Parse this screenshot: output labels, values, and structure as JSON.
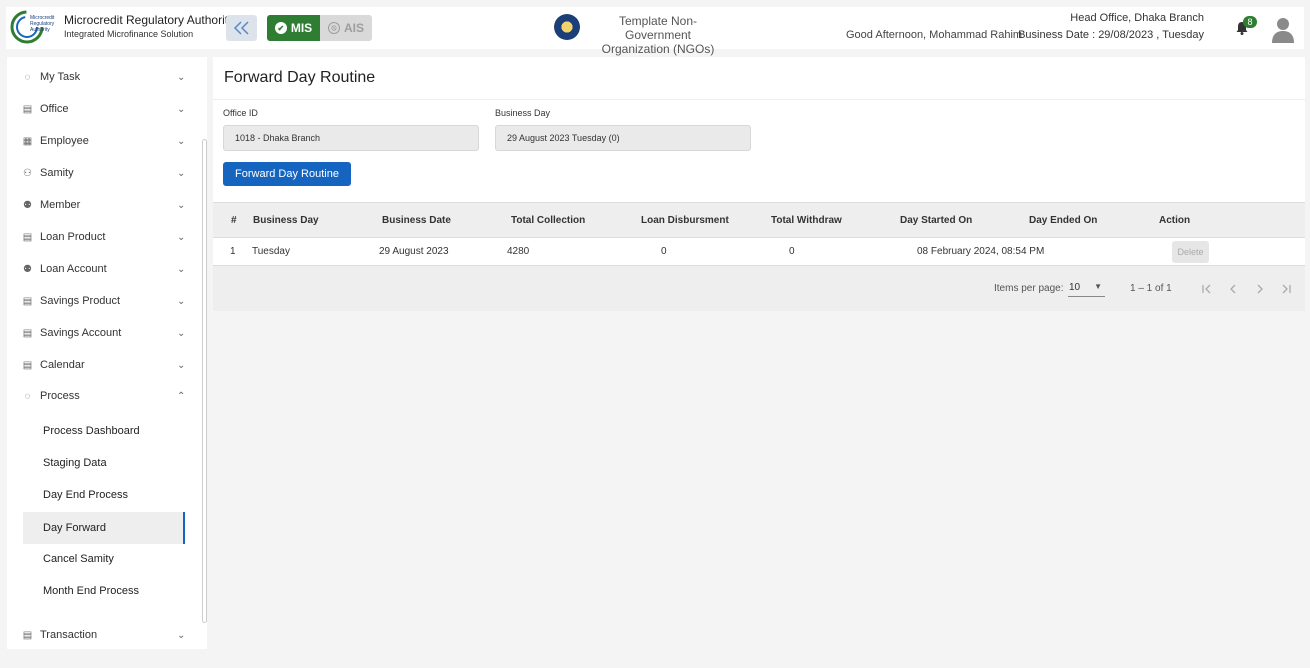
{
  "header": {
    "logo_text": [
      "Microcredit",
      "Regulatory",
      "Authority"
    ],
    "brand_title": "Microcredit Regulatory Authority",
    "brand_subtitle": "Integrated Microfinance Solution",
    "toggle": {
      "mis": "MIS",
      "ais": "AIS",
      "active": "MIS"
    },
    "ngo_name_line1": "Template Non-Government",
    "ngo_name_line2": "Organization (NGOs)",
    "greeting": "Good Afternoon, Mohammad Rahim",
    "branch": "Head Office, Dhaka Branch",
    "business_date": "Business Date : 29/08/2023 , Tuesday",
    "notification_count": "8",
    "colors": {
      "accent": "#2e7d32",
      "primary": "#1565c0"
    }
  },
  "sidebar": {
    "items": [
      {
        "label": "My Task",
        "icon": "task-icon",
        "expanded": false
      },
      {
        "label": "Office",
        "icon": "office-icon",
        "expanded": false
      },
      {
        "label": "Employee",
        "icon": "employee-icon",
        "expanded": false
      },
      {
        "label": "Samity",
        "icon": "samity-icon",
        "expanded": false
      },
      {
        "label": "Member",
        "icon": "member-icon",
        "expanded": false
      },
      {
        "label": "Loan Product",
        "icon": "loan-product-icon",
        "expanded": false
      },
      {
        "label": "Loan Account",
        "icon": "loan-account-icon",
        "expanded": false
      },
      {
        "label": "Savings Product",
        "icon": "savings-product-icon",
        "expanded": false
      },
      {
        "label": "Savings Account",
        "icon": "savings-account-icon",
        "expanded": false
      },
      {
        "label": "Calendar",
        "icon": "calendar-icon",
        "expanded": false
      },
      {
        "label": "Process",
        "icon": "process-icon",
        "expanded": true
      },
      {
        "label": "Transaction",
        "icon": "transaction-icon",
        "expanded": false
      }
    ],
    "process_sub": [
      {
        "label": "Process Dashboard"
      },
      {
        "label": "Staging Data"
      },
      {
        "label": "Day End Process"
      },
      {
        "label": "Day Forward",
        "active": true
      },
      {
        "label": "Cancel Samity"
      },
      {
        "label": "Month End Process"
      }
    ]
  },
  "main": {
    "title": "Forward Day Routine",
    "office_id_label": "Office ID",
    "office_id_value": "1018 - Dhaka Branch",
    "business_day_label": "Business Day",
    "business_day_value": "29 August 2023 Tuesday (0)",
    "forward_button": "Forward Day Routine",
    "table": {
      "columns": [
        "#",
        "Business Day",
        "Business Date",
        "Total Collection",
        "Loan Disbursment",
        "Total Withdraw",
        "Day Started On",
        "Day Ended On",
        "Action"
      ],
      "rows": [
        {
          "num": "1",
          "business_day": "Tuesday",
          "business_date": "29 August 2023",
          "total_collection": "4280",
          "loan_disbursment": "0",
          "total_withdraw": "0",
          "day_started_on": "08 February 2024, 08:54 PM",
          "day_ended_on": "",
          "action": "Delete"
        }
      ]
    },
    "paginator": {
      "items_per_page_label": "Items per page:",
      "items_per_page": "10",
      "range": "1 – 1 of 1"
    }
  }
}
